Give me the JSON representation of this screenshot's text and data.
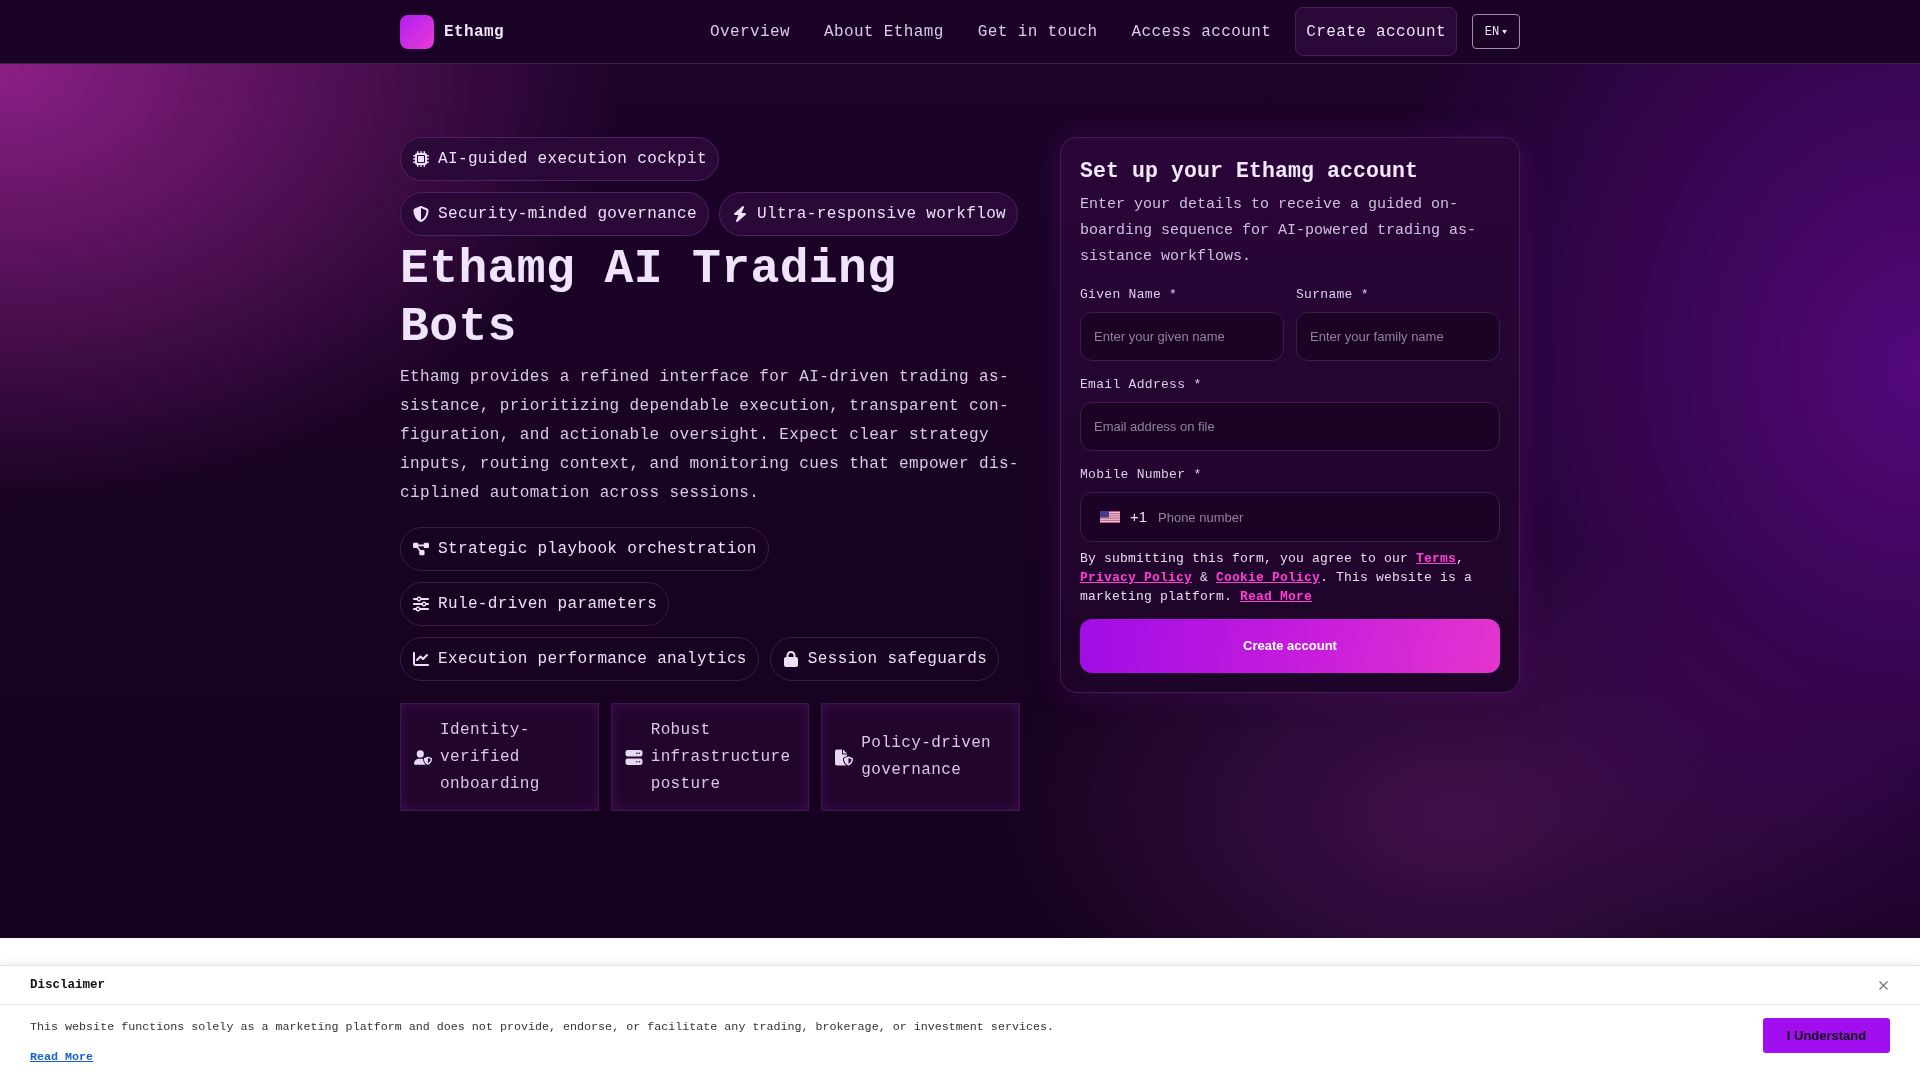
{
  "nav": {
    "brand": "Ethamg",
    "links": [
      "Overview",
      "About Ethamg",
      "Get in touch",
      "Access account"
    ],
    "cta": "Create account",
    "language": "EN"
  },
  "hero": {
    "badge_rows": [
      {
        "badges": [
          "AI-guided execution cockpit"
        ]
      },
      {
        "badges": [
          "Security-minded governance",
          "Ultra-responsive workflow"
        ]
      }
    ],
    "title": "Ethamg AI Trading Bots",
    "description": "Ethamg provides a refined interface for AI-driven trading as- sistance, prioritizing dependable execution, transparent con- figuration, and actionable oversight. Expect clear strategy inputs, routing context, and monitoring cues that empower dis- ciplined automation across sessions.",
    "feature_rows": [
      {
        "items": [
          "Strategic playbook orchestration"
        ]
      },
      {
        "items": [
          "Rule-driven parameters"
        ]
      },
      {
        "items": [
          "Execution performance analytics",
          "Session safeguards"
        ]
      }
    ],
    "cards": [
      "Identity-verified onboarding",
      "Robust infrastructure posture",
      "Policy-driven governance"
    ]
  },
  "signup": {
    "title": "Set up your Ethamg account",
    "description": "Enter your details to receive a guided on- boarding sequence for AI-powered trading as- sistance workflows.",
    "name_fields": [
      {
        "label": "Given Name *",
        "placeholder": "Enter your given name"
      },
      {
        "label": "Surname *",
        "placeholder": "Enter your family name"
      }
    ],
    "email_field": {
      "label": "Email Address *",
      "placeholder": "Email address on file"
    },
    "phone_field": {
      "label": "Mobile Number *",
      "dial_code": "+1",
      "placeholder": "Phone number"
    },
    "consent": [
      {
        "kind": "text",
        "text": "By submitting this form, you agree to our "
      },
      {
        "kind": "link",
        "text": "Terms"
      },
      {
        "kind": "text",
        "text": ", "
      },
      {
        "kind": "link",
        "text": "Privacy Policy"
      },
      {
        "kind": "text",
        "text": " & "
      },
      {
        "kind": "link",
        "text": "Cookie Policy"
      },
      {
        "kind": "text",
        "text": ". This website is a marketing platform. "
      },
      {
        "kind": "link",
        "text": "Read More"
      }
    ],
    "submit": "Create account"
  },
  "disclaimer": {
    "title": "Disclaimer",
    "text": "This website functions solely as a marketing platform and does not provide, endorse, or facilitate any trading, brokerage, or investment services.",
    "link": "Read More",
    "button": "I Understand"
  }
}
